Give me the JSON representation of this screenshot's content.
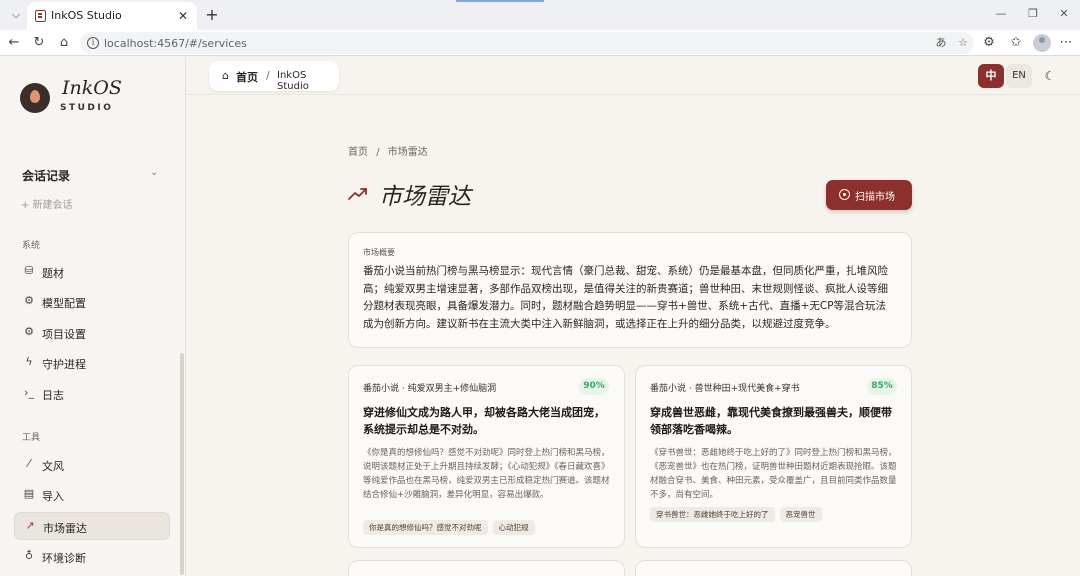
{
  "browser": {
    "tab_title": "InkOS Studio",
    "url": "localhost:4567/#/services"
  },
  "sidebar": {
    "logo_name": "InkOS",
    "logo_sub": "STUDIO",
    "sessions_header": "会话记录",
    "new_session": "+ 新建会话",
    "system_label": "系统",
    "system_items": [
      {
        "label": "题材",
        "icon": "book-stack-icon"
      },
      {
        "label": "模型配置",
        "icon": "gear-icon"
      },
      {
        "label": "项目设置",
        "icon": "settings-icon"
      },
      {
        "label": "守护进程",
        "icon": "lightning-icon"
      },
      {
        "label": "日志",
        "icon": "terminal-icon"
      }
    ],
    "tools_label": "工具",
    "tool_items": [
      {
        "label": "文风",
        "icon": "wand-icon"
      },
      {
        "label": "导入",
        "icon": "file-import-icon"
      },
      {
        "label": "市场雷达",
        "icon": "trending-up-icon",
        "active": true
      },
      {
        "label": "环境诊断",
        "icon": "stethoscope-icon"
      }
    ]
  },
  "topbar": {
    "home": "首页",
    "separator": "/",
    "current": "InkOS Studio",
    "lang_zh": "中",
    "lang_en": "EN"
  },
  "page": {
    "breadcrumb": [
      "首页",
      "/",
      "市场雷达"
    ],
    "title": "市场雷达",
    "scan_button": "扫描市场",
    "accent": "#8b302c"
  },
  "overview": {
    "label": "市场概要",
    "text": "番茄小说当前热门榜与黑马榜显示：现代言情（豪门总裁、甜宠、系统）仍是最基本盘，但同质化严重，扎堆风险高；纯爱双男主增速显著，多部作品双榜出现，是值得关注的新贵赛道；兽世种田、末世规则怪谈、疯批人设等细分题材表现亮眼，具备爆发潜力。同时，题材融合趋势明显——穿书+兽世、系统+古代、直播+无CP等混合玩法成为创新方向。建议新书在主流大类中注入新鲜脑洞，或选择正在上升的细分品类，以规避过度竞争。"
  },
  "trends": [
    {
      "tag": "番茄小说 · 纯爱双男主+修仙脑洞",
      "percent": "90%",
      "title": "穿进修仙文成为路人甲，却被各路大佬当成团宠，系统提示却总是不对劲。",
      "desc": "《你是真的想修仙吗？感觉不对劲呢》同时登上热门榜和黑马榜，说明该题材正处于上升期且持续发酵；《心动犯规》《春日藏欢喜》等纯爱作品也在黑马榜，纯爱双男主已形成稳定热门赛道。该题材结合修仙+沙雕脑洞，差异化明显，容易出爆款。",
      "chips": [
        "你是真的想修仙吗？感觉不对劲呢",
        "心动犯规"
      ]
    },
    {
      "tag": "番茄小说 · 兽世种田+现代美食+穿书",
      "percent": "85%",
      "title": "穿成兽世恶雌，靠现代美食撩到最强兽夫，顺便带领部落吃香喝辣。",
      "desc": "《穿书兽世：恶雌她终于吃上好的了》同时登上热门榜和黑马榜，《恶宠兽世》也在热门榜，证明兽世种田题材近期表现抢眼。该题材融合穿书、美食、种田元素，受众覆盖广，且目前同类作品数量不多，尚有空间。",
      "chips": [
        "穿书兽世：恶雌她终于吃上好的了",
        "恶宠兽世"
      ]
    }
  ]
}
